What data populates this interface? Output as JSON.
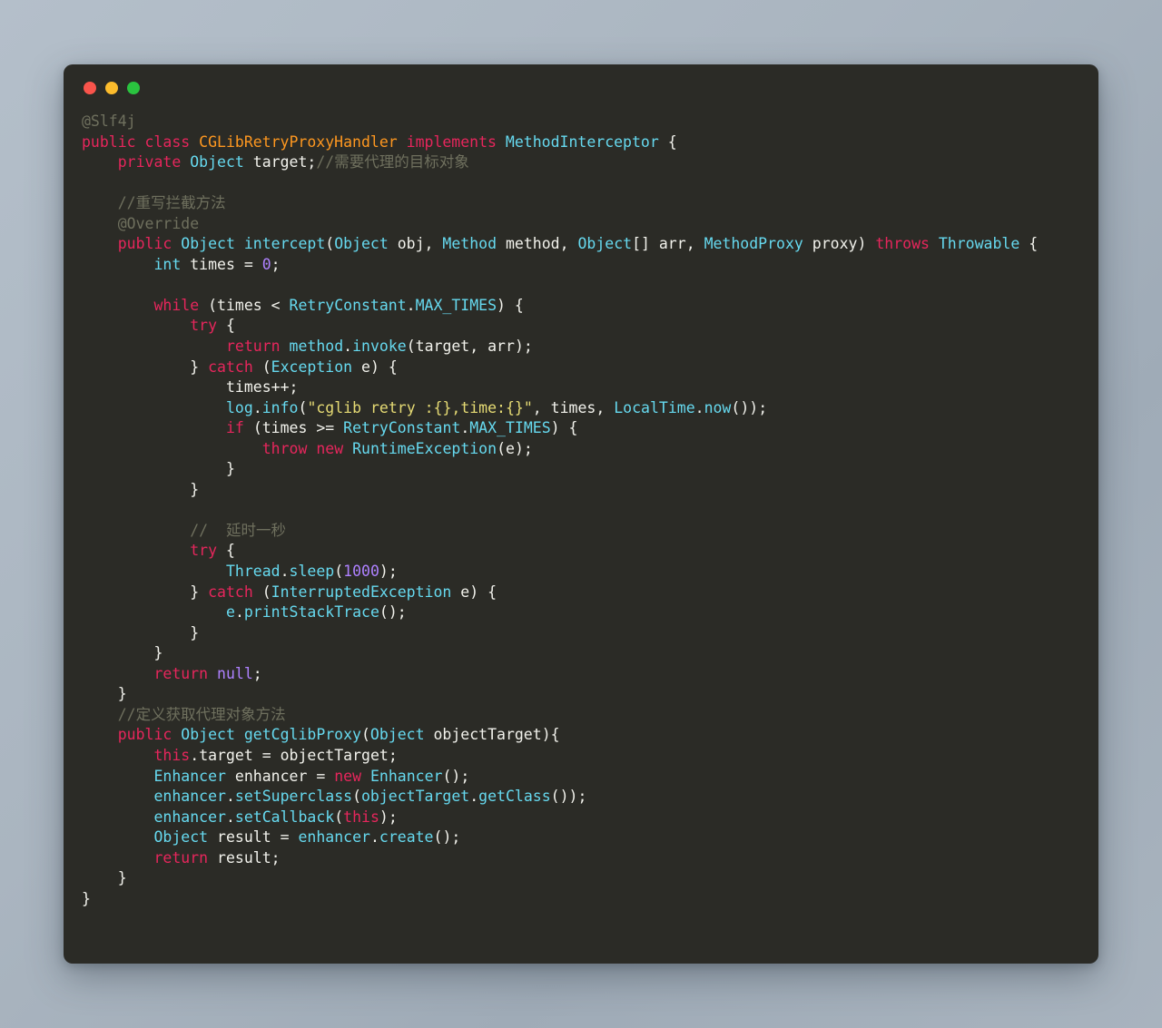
{
  "window": {
    "traffic_lights": [
      {
        "name": "close",
        "color": "#f9544b"
      },
      {
        "name": "minimize",
        "color": "#fcbc2c"
      },
      {
        "name": "maximize",
        "color": "#2ac33f"
      }
    ],
    "background_color": "#2b2b26",
    "page_background": "#aab5c0"
  },
  "theme": {
    "keyword": "#e6265c",
    "type": "#66d9ef",
    "class_name": "#fd9720",
    "string": "#e6db74",
    "number": "#ae81ff",
    "comment": "#6f705e",
    "plain": "#f2f2ec"
  },
  "code": {
    "language": "java",
    "class_name": "CGLibRetryProxyHandler",
    "lines": [
      "@Slf4j",
      "public class CGLibRetryProxyHandler implements MethodInterceptor {",
      "    private Object target;//需要代理的目标对象",
      "",
      "    //重写拦截方法",
      "    @Override",
      "    public Object intercept(Object obj, Method method, Object[] arr, MethodProxy proxy) throws Throwable {",
      "        int times = 0;",
      "",
      "        while (times < RetryConstant.MAX_TIMES) {",
      "            try {",
      "                return method.invoke(target, arr);",
      "            } catch (Exception e) {",
      "                times++;",
      "                log.info(\"cglib retry :{},time:{}\", times, LocalTime.now());",
      "                if (times >= RetryConstant.MAX_TIMES) {",
      "                    throw new RuntimeException(e);",
      "                }",
      "            }",
      "",
      "            //  延时一秒",
      "            try {",
      "                Thread.sleep(1000);",
      "            } catch (InterruptedException e) {",
      "                e.printStackTrace();",
      "            }",
      "        }",
      "        return null;",
      "    }",
      "    //定义获取代理对象方法",
      "    public Object getCglibProxy(Object objectTarget){",
      "        this.target = objectTarget;",
      "        Enhancer enhancer = new Enhancer();",
      "        enhancer.setSuperclass(objectTarget.getClass());",
      "        enhancer.setCallback(this);",
      "        Object result = enhancer.create();",
      "        return result;",
      "    }",
      "}"
    ],
    "annotations": [
      "@Slf4j",
      "@Override"
    ],
    "comments": [
      "//需要代理的目标对象",
      "//重写拦截方法",
      "//  延时一秒",
      "//定义获取代理对象方法"
    ],
    "string_literals": [
      "\"cglib retry :{},time:{}\""
    ],
    "numeric_literals": [
      "0",
      "1000"
    ]
  }
}
